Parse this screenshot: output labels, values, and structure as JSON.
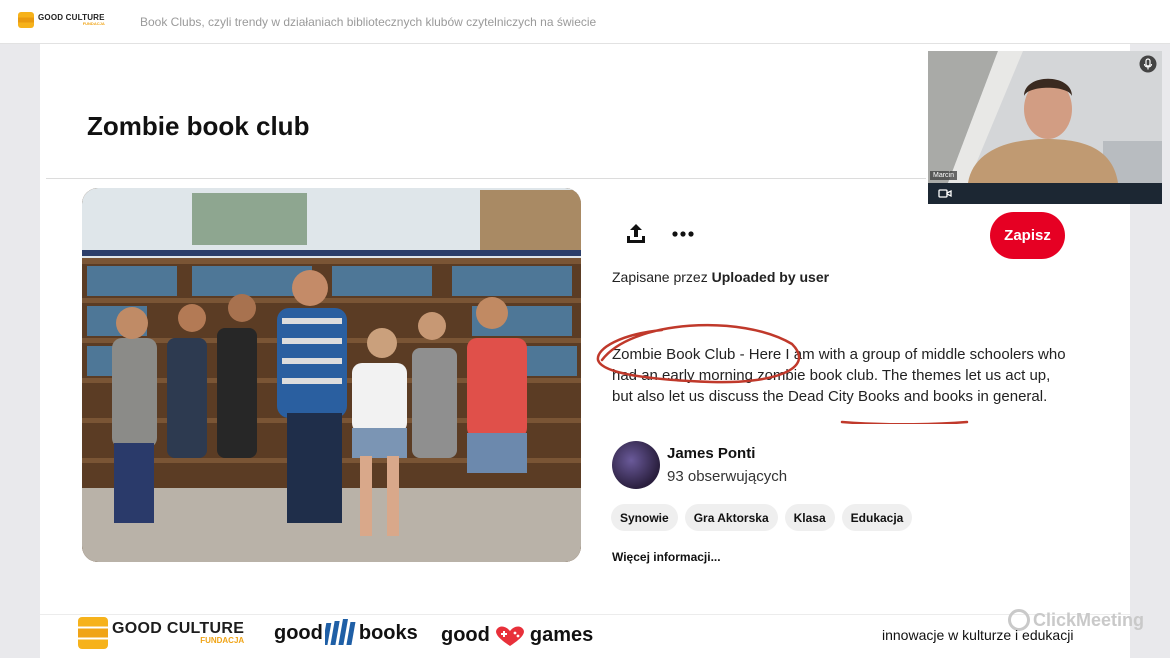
{
  "topbar": {
    "brand_name": "GOOD CULTURE",
    "brand_sub": "FUNDACJA",
    "title": "Book Clubs, czyli trendy w działaniach bibliotecznych klubów czytelniczych na świecie"
  },
  "slide": {
    "title": "Zombie book club"
  },
  "pin": {
    "save_label": "Zapisz",
    "saved_by_prefix": "Zapisane przez",
    "saved_by_user": "Uploaded by user",
    "desc_title": "Zombie Book Club",
    "desc_part1": " - Here I am with a group of middle schoolers who had an early morning zombie book club. The themes let us act up, but also let us discuss the ",
    "desc_link": "Dead City Books",
    "desc_part2": " and books in general.",
    "author_name": "James Ponti",
    "author_followers": "93 obserwujących",
    "tags": [
      "Synowie",
      "Gra Aktorska",
      "Klasa",
      "Edukacja"
    ],
    "more_info": "Więcej informacji..."
  },
  "video": {
    "participant_name": "Marcin"
  },
  "footer": {
    "gc_name": "GOOD CULTURE",
    "gc_sub": "FUNDACJA",
    "goodbooks_a": "good",
    "goodbooks_b": "books",
    "goodgames_a": "good",
    "goodgames_b": "games",
    "tagline": "innowacje w kulturze i edukacji",
    "clickmeeting": "ClickMeeting"
  },
  "colors": {
    "save_red": "#e60023",
    "annotation_red": "#c0392b",
    "brand_orange": "#f0a416"
  }
}
